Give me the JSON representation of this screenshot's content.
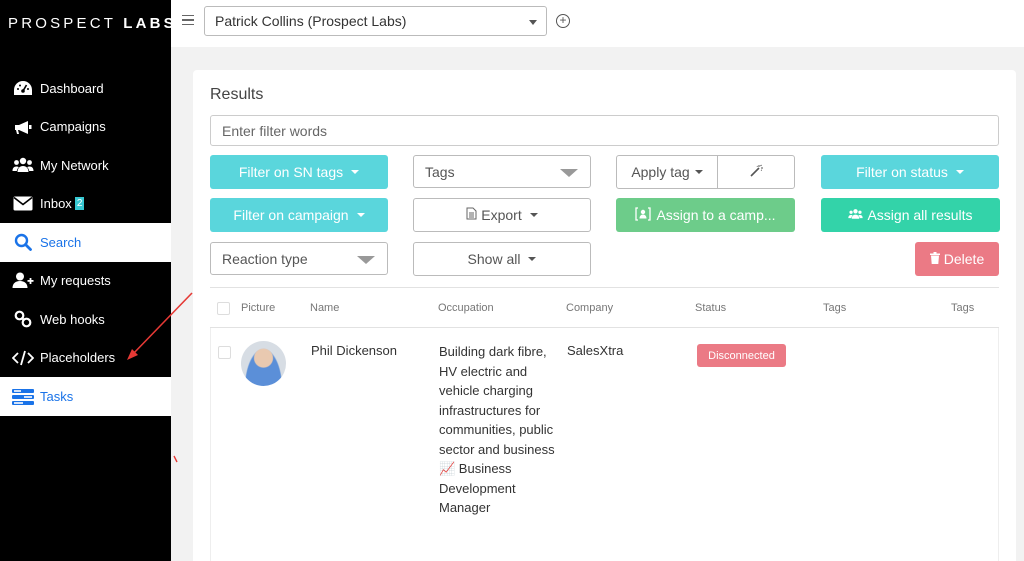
{
  "brand": {
    "light": "PROSPECT ",
    "bold": "LABS"
  },
  "sidebar": {
    "items": [
      {
        "label": "Dashboard",
        "icon": "dashboard-icon"
      },
      {
        "label": "Campaigns",
        "icon": "megaphone-icon"
      },
      {
        "label": "My Network",
        "icon": "users-icon"
      },
      {
        "label": "Inbox",
        "icon": "envelope-icon",
        "badge": "2"
      },
      {
        "label": "Search",
        "icon": "search-icon",
        "active": true
      },
      {
        "label": "My requests",
        "icon": "user-plus-icon"
      },
      {
        "label": "Web hooks",
        "icon": "link-icon"
      },
      {
        "label": "Placeholders",
        "icon": "code-icon"
      },
      {
        "label": "Tasks",
        "icon": "tasks-icon",
        "active": true
      }
    ]
  },
  "topbar": {
    "account": "Patrick Collins (Prospect Labs)"
  },
  "results": {
    "title": "Results",
    "filter_placeholder": "Enter filter words",
    "buttons": {
      "filter_sn_tags": "Filter on SN tags",
      "tags": "Tags",
      "apply_tag": "Apply tag",
      "filter_status": "Filter on status",
      "filter_campaign": "Filter on campaign",
      "export": "Export",
      "assign_campaign": "Assign to a camp...",
      "assign_all": "Assign all results",
      "reaction_type": "Reaction type",
      "show_all": "Show all",
      "delete": "Delete"
    }
  },
  "table": {
    "headers": [
      "Picture",
      "Name",
      "Occupation",
      "Company",
      "Status",
      "Tags",
      "Tags"
    ],
    "rows": [
      {
        "name": "Phil Dickenson",
        "occupation": "Building dark fibre, HV electric and vehicle charging infrastructures for communities, public sector and business 📈 Business Development Manager",
        "company": "SalesXtra",
        "status": "Disconnected"
      }
    ]
  },
  "colors": {
    "cyan": "#5ad6dc",
    "green": "#6dcc8a",
    "teal": "#33d3a9",
    "red": "#eb7a85",
    "active_link": "#1a73e8"
  }
}
